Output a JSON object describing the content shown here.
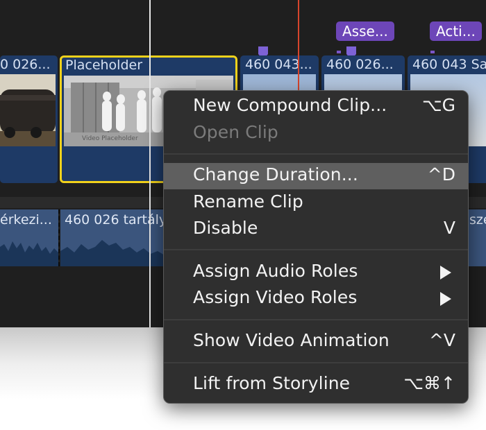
{
  "timeline": {
    "markers": [
      {
        "label": "Asse..."
      },
      {
        "label": "Acti..."
      }
    ],
    "clips": [
      {
        "title": "0 026..."
      },
      {
        "title": "Placeholder"
      },
      {
        "title": "460 043..."
      },
      {
        "title": "460 026..."
      },
      {
        "title": "460 043 Sa"
      }
    ],
    "placeholder_caption": "Video Placeholder",
    "audio_clips": [
      {
        "title": "érkezi..."
      },
      {
        "title": "460 026 tartály"
      },
      {
        "title": "sze"
      }
    ]
  },
  "context_menu": {
    "items": [
      {
        "label": "New Compound Clip...",
        "shortcut": "⌥G",
        "disabled": false
      },
      {
        "label": "Open Clip",
        "shortcut": "",
        "disabled": true
      },
      {
        "label": "Change Duration...",
        "shortcut": "^D",
        "highlighted": true
      },
      {
        "label": "Rename Clip",
        "shortcut": ""
      },
      {
        "label": "Disable",
        "shortcut": "V"
      },
      {
        "label": "Assign Audio Roles",
        "submenu": true
      },
      {
        "label": "Assign Video Roles",
        "submenu": true
      },
      {
        "label": "Show Video Animation",
        "shortcut": "^V"
      },
      {
        "label": "Lift from Storyline",
        "shortcut": "⌥⌘↑"
      }
    ]
  },
  "colors": {
    "playhead": "#d8452c",
    "skimmer": "#e8e8e8",
    "selection": "#f2d21b",
    "marker": "#6d46b8",
    "clip": "#1e3a66",
    "menu_highlight": "#5f5f5f"
  }
}
